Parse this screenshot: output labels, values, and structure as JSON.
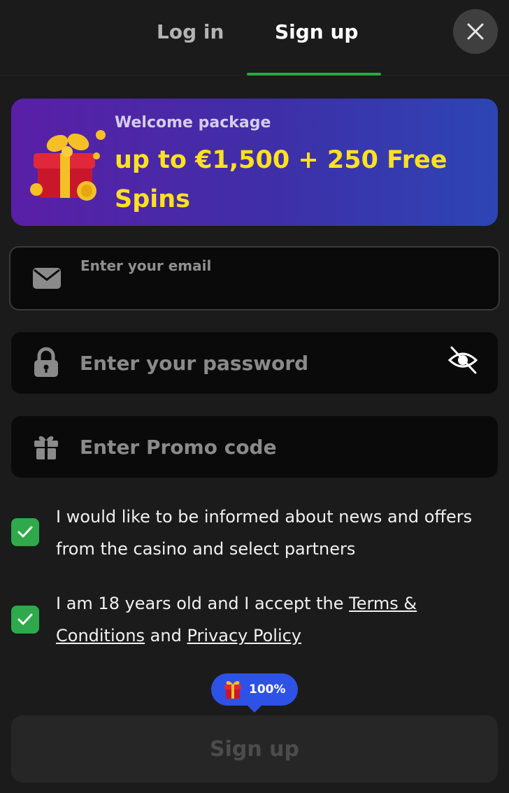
{
  "tabs": {
    "login": "Log in",
    "signup": "Sign up",
    "active": "signup"
  },
  "banner": {
    "subtitle": "Welcome package",
    "title": "up to €1,500 + 250 Free Spins"
  },
  "form": {
    "email_label": "Enter your email",
    "email_value": "",
    "password_placeholder": "Enter your password",
    "password_value": "",
    "promo_placeholder": "Enter Promo code",
    "promo_value": ""
  },
  "consents": {
    "news": {
      "checked": true,
      "text": "I would like to be informed about news and offers from the casino and select partners"
    },
    "age": {
      "checked": true,
      "text_before": "I am 18 years old and I accept the ",
      "terms_link": "Terms & Conditions",
      "text_middle": " and ",
      "privacy_link": "Privacy Policy"
    }
  },
  "bonus_badge": {
    "percent": "100%"
  },
  "submit": {
    "label": "Sign up",
    "enabled": false
  },
  "icons": {
    "close": "close-icon",
    "envelope": "envelope-icon",
    "lock": "lock-icon",
    "eye_off": "eye-off-icon",
    "gift": "gift-icon",
    "check": "check-icon"
  },
  "colors": {
    "background": "#1b1b1b",
    "accent_green": "#27a844",
    "banner_title": "#ffe11f",
    "banner_gradient_start": "#5a1fa6",
    "banner_gradient_end": "#2d45b5",
    "badge_blue": "#2e52e6"
  }
}
